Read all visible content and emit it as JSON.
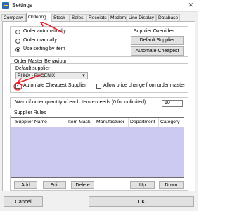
{
  "window": {
    "title": "Settings",
    "close_glyph": "✕"
  },
  "tabs": [
    {
      "label": "Company"
    },
    {
      "label": "Ordering",
      "active": true
    },
    {
      "label": "Stock"
    },
    {
      "label": "Sales"
    },
    {
      "label": "Receipts"
    },
    {
      "label": "Modem"
    },
    {
      "label": "Line Display"
    },
    {
      "label": "Database"
    }
  ],
  "ordering": {
    "radio_options": [
      {
        "label": "Order automatically",
        "checked": false
      },
      {
        "label": "Order manually",
        "checked": false
      },
      {
        "label": "Use setting by item",
        "checked": true
      }
    ],
    "supplier_overrides": {
      "label": "Supplier Overrides",
      "default_supplier_button": "Default Supplier",
      "automate_cheapest_button": "Automate Cheapest"
    },
    "master_behaviour": {
      "title": "Order Master Behaviour",
      "default_supplier_label": "Default supplier",
      "default_supplier_value": "PHNX - PHOENIX",
      "automate_cheapest_label": "Automate Cheapest Supplier",
      "automate_cheapest_checked": true,
      "allow_price_change_label": "Allow price change from order master",
      "allow_price_change_checked": false
    },
    "warn_label": "Warn if order quantity of each item exceeds (0 for unlimited):",
    "warn_value": "10",
    "supplier_rules": {
      "title": "Supplier Rules",
      "columns": [
        "Supplier Name",
        "Item Mask",
        "Manufacturer",
        "Department",
        "Category"
      ],
      "buttons": {
        "add": "Add",
        "edit": "Edit",
        "delete": "Delete",
        "up": "Up",
        "down": "Down"
      }
    }
  },
  "footer": {
    "cancel_label": "Cancel",
    "ok_label": "OK"
  },
  "colors": {
    "annotation_arrow": "#e8202a",
    "rules_background": "#cdcaf2"
  }
}
